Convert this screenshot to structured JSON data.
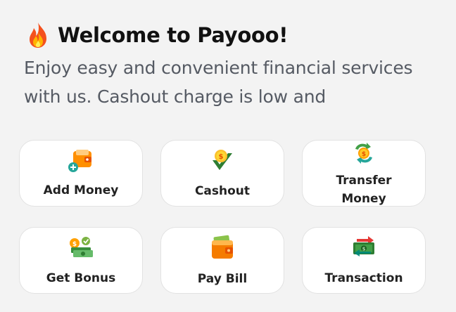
{
  "header": {
    "title": "Welcome to Payooo!",
    "icon": "fire-icon",
    "description": "Enjoy easy and convenient financial services with us. Cashout charge is low and"
  },
  "services": [
    {
      "label": "Add Money",
      "icon": "wallet-add-icon"
    },
    {
      "label": "Cashout",
      "icon": "coin-check-icon"
    },
    {
      "label": "Transfer Money",
      "icon": "transfer-coin-icon"
    },
    {
      "label": "Get Bonus",
      "icon": "bonus-money-icon"
    },
    {
      "label": "Pay Bill",
      "icon": "wallet-icon"
    },
    {
      "label": "Transaction",
      "icon": "money-transfer-icon"
    }
  ],
  "colors": {
    "background": "#f3f3f3",
    "card": "#ffffff",
    "text": "#222222",
    "description": "#555a63"
  }
}
